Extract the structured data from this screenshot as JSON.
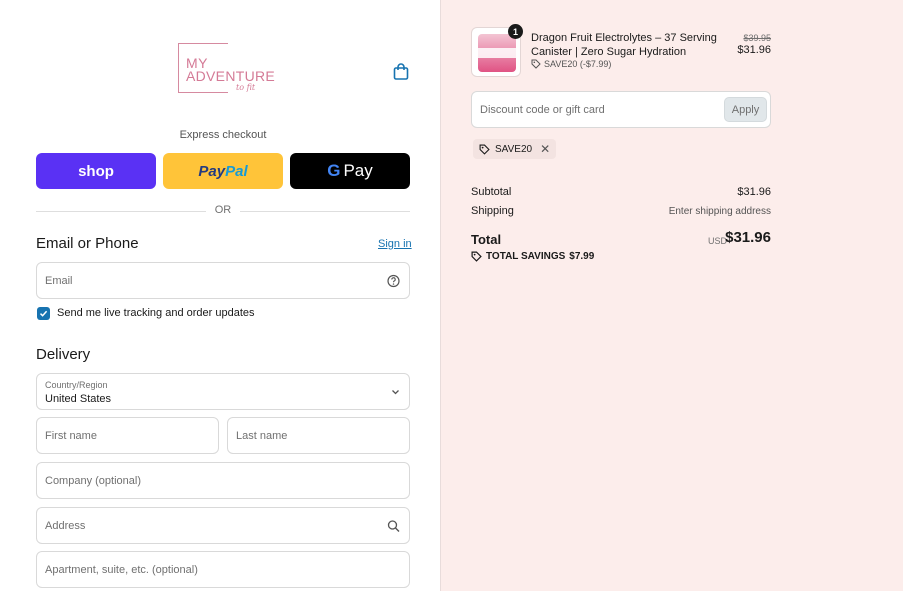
{
  "brand": {
    "line1": "MY",
    "line2": "ADVENTURE",
    "line3": "to fit"
  },
  "express": {
    "label": "Express checkout",
    "shop": "shop",
    "paypal_a": "Pay",
    "paypal_b": "Pal",
    "gpay_g": "G",
    "gpay_text": "Pay"
  },
  "divider": "OR",
  "contact": {
    "title": "Email or Phone",
    "sign_in": "Sign in",
    "email_placeholder": "Email",
    "updates_label": "Send me live tracking and order updates",
    "updates_checked": true
  },
  "delivery": {
    "title": "Delivery",
    "country_label": "Country/Region",
    "country_value": "United States",
    "first_name": "First name",
    "last_name": "Last name",
    "company": "Company (optional)",
    "address": "Address",
    "apartment": "Apartment, suite, etc. (optional)"
  },
  "cart": {
    "quantity": "1",
    "product_name": "Dragon Fruit Electrolytes – 37 Serving Canister | Zero Sugar Hydration",
    "discount_line": "SAVE20 (-$7.99)",
    "old_price": "$39.95",
    "new_price": "$31.96"
  },
  "discount": {
    "placeholder": "Discount code or gift card",
    "apply": "Apply",
    "applied_code": "SAVE20"
  },
  "summary": {
    "subtotal_label": "Subtotal",
    "subtotal_value": "$31.96",
    "shipping_label": "Shipping",
    "shipping_value": "Enter shipping address",
    "total_label": "Total",
    "currency": "USD",
    "total_value": "$31.96",
    "savings_label": "TOTAL SAVINGS",
    "savings_value": "$7.99"
  },
  "colors": {
    "shop": "#5a31f4",
    "paypal": "#ffc439",
    "link": "#1773b0",
    "sidebar_bg": "#fcedeb"
  }
}
